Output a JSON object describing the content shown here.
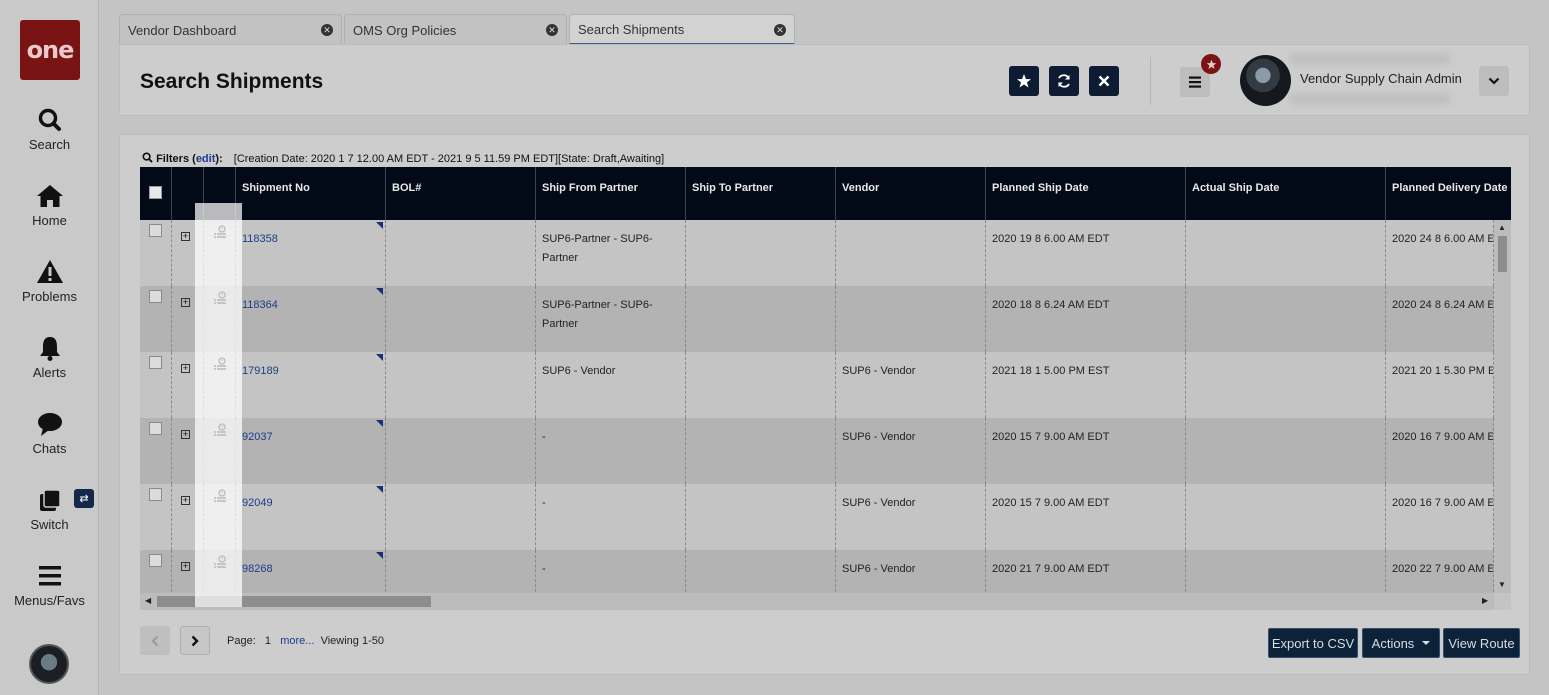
{
  "logo": {
    "text": "one"
  },
  "sidebar": {
    "items": [
      {
        "label": "Search",
        "icon": "search-icon"
      },
      {
        "label": "Home",
        "icon": "home-icon"
      },
      {
        "label": "Problems",
        "icon": "warning-icon"
      },
      {
        "label": "Alerts",
        "icon": "bell-icon"
      },
      {
        "label": "Chats",
        "icon": "chat-icon"
      },
      {
        "label": "Switch",
        "icon": "switch-icon"
      },
      {
        "label": "Menus/Favs",
        "icon": "menu-icon"
      }
    ],
    "switch_badge": "⇄"
  },
  "tabs": [
    {
      "label": "Vendor Dashboard"
    },
    {
      "label": "OMS Org Policies"
    },
    {
      "label": "Search Shipments"
    }
  ],
  "header": {
    "title": "Search Shipments",
    "user_role": "Vendor Supply Chain Admin"
  },
  "filters": {
    "label": "Filters",
    "edit": "edit",
    "text": "[Creation Date: 2020 1 7 12.00 AM EDT - 2021 9 5 11.59 PM EDT][State: Draft,Awaiting]"
  },
  "table": {
    "columns": [
      "Shipment No",
      "BOL#",
      "Ship From Partner",
      "Ship To Partner",
      "Vendor",
      "Planned Ship Date",
      "Actual Ship Date",
      "Planned Delivery Date"
    ],
    "rows": [
      {
        "shipment_no": "118358",
        "bol": "",
        "ship_from": "SUP6-Partner - SUP6-Partner",
        "ship_to": "",
        "vendor": "",
        "planned_ship": "2020 19 8 6.00 AM EDT",
        "actual_ship": "",
        "planned_delivery": "2020 24 8 6.00 AM E"
      },
      {
        "shipment_no": "118364",
        "bol": "",
        "ship_from": "SUP6-Partner - SUP6-Partner",
        "ship_to": "",
        "vendor": "",
        "planned_ship": "2020 18 8 6.24 AM EDT",
        "actual_ship": "",
        "planned_delivery": "2020 24 8 6.24 AM E"
      },
      {
        "shipment_no": "179189",
        "bol": "",
        "ship_from": "SUP6 - Vendor",
        "ship_to": "",
        "vendor": "SUP6 - Vendor",
        "planned_ship": "2021 18 1 5.00 PM EST",
        "actual_ship": "",
        "planned_delivery": "2021 20 1 5.30 PM E"
      },
      {
        "shipment_no": "92037",
        "bol": "",
        "ship_from": "-",
        "ship_to": "",
        "vendor": "SUP6 - Vendor",
        "planned_ship": "2020 15 7 9.00 AM EDT",
        "actual_ship": "",
        "planned_delivery": "2020 16 7 9.00 AM E"
      },
      {
        "shipment_no": "92049",
        "bol": "",
        "ship_from": "-",
        "ship_to": "",
        "vendor": "SUP6 - Vendor",
        "planned_ship": "2020 15 7 9.00 AM EDT",
        "actual_ship": "",
        "planned_delivery": "2020 16 7 9.00 AM E"
      },
      {
        "shipment_no": "98268",
        "bol": "",
        "ship_from": "-",
        "ship_to": "",
        "vendor": "SUP6 - Vendor",
        "planned_ship": "2020 21 7 9.00 AM EDT",
        "actual_ship": "",
        "planned_delivery": "2020 22 7 9.00 AM E"
      }
    ]
  },
  "pagination": {
    "page_label": "Page:",
    "page": "1",
    "more": "more...",
    "viewing": "Viewing 1-50"
  },
  "footer_buttons": {
    "export": "Export to CSV",
    "actions": "Actions",
    "view_route": "View Route"
  },
  "colors": {
    "brand": "#7a1414",
    "header_bg": "#030a17",
    "button_dark": "#0d1c33",
    "link": "#1c3d8a"
  }
}
